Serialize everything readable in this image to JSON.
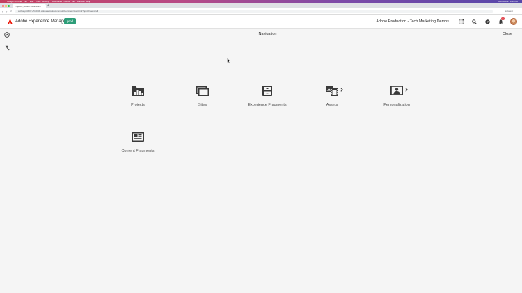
{
  "mac_menu": {
    "app": "Google Chrome",
    "items": [
      "File",
      "Edit",
      "View",
      "History",
      "Bookmarks",
      "Profiles",
      "Tab",
      "Window",
      "Help"
    ],
    "clock": "Mon Feb 13  3:14 PM"
  },
  "browser": {
    "tab_title": "Projects | Adobe Experience",
    "url": "author-p63007-e510036.adobeaemcloud.com/ui#/aem/aem/start.html?appId=aemshell",
    "profile_label": "Guest"
  },
  "header": {
    "product_name": "Adobe Experience Manager",
    "env_badge": "prod",
    "org_name": "Adobe Production - Tech Marketing Demos",
    "notification_count": "3",
    "brand_color": "#eb1000",
    "badge_color": "#2d9d78"
  },
  "nav": {
    "title": "Navigation",
    "close_label": "Close"
  },
  "tiles": [
    {
      "label": "Projects",
      "icon": "projects-icon"
    },
    {
      "label": "Sites",
      "icon": "sites-icon"
    },
    {
      "label": "Experience Fragments",
      "icon": "experience-fragments-icon"
    },
    {
      "label": "Assets",
      "icon": "assets-icon"
    },
    {
      "label": "Personalization",
      "icon": "personalization-icon"
    },
    {
      "label": "Content Fragments",
      "icon": "content-fragments-icon"
    }
  ],
  "rail": {
    "icons": [
      "compass-icon",
      "hammer-icon"
    ]
  }
}
